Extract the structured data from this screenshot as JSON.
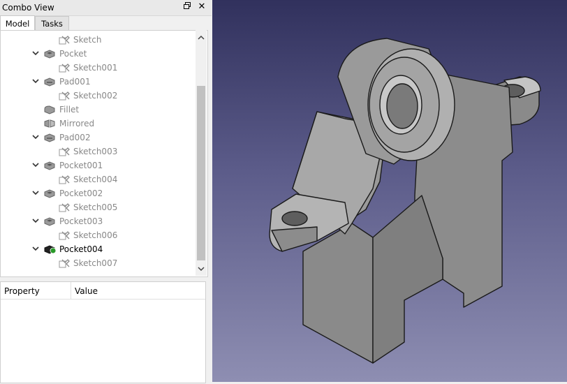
{
  "panel": {
    "title": "Combo View",
    "float_icon": "float-window-icon",
    "close_icon": "close-icon"
  },
  "tabs": [
    {
      "label": "Model",
      "active": true
    },
    {
      "label": "Tasks",
      "active": false
    }
  ],
  "tree": {
    "items": [
      {
        "label": "Sketch",
        "icon": "sketch-icon",
        "level": 2,
        "expanded": null
      },
      {
        "label": "Pocket",
        "icon": "pocket-icon",
        "level": 1,
        "expanded": true
      },
      {
        "label": "Sketch001",
        "icon": "sketch-icon",
        "level": 2,
        "expanded": null
      },
      {
        "label": "Pad001",
        "icon": "pad-icon",
        "level": 1,
        "expanded": true
      },
      {
        "label": "Sketch002",
        "icon": "sketch-icon",
        "level": 2,
        "expanded": null
      },
      {
        "label": "Fillet",
        "icon": "fillet-icon",
        "level": 1,
        "expanded": null
      },
      {
        "label": "Mirrored",
        "icon": "mirrored-icon",
        "level": 1,
        "expanded": null
      },
      {
        "label": "Pad002",
        "icon": "pad-icon",
        "level": 1,
        "expanded": true
      },
      {
        "label": "Sketch003",
        "icon": "sketch-icon",
        "level": 2,
        "expanded": null
      },
      {
        "label": "Pocket001",
        "icon": "pocket-icon",
        "level": 1,
        "expanded": true
      },
      {
        "label": "Sketch004",
        "icon": "sketch-icon",
        "level": 2,
        "expanded": null
      },
      {
        "label": "Pocket002",
        "icon": "pocket-icon",
        "level": 1,
        "expanded": true
      },
      {
        "label": "Sketch005",
        "icon": "sketch-icon",
        "level": 2,
        "expanded": null
      },
      {
        "label": "Pocket003",
        "icon": "pocket-icon",
        "level": 1,
        "expanded": true
      },
      {
        "label": "Sketch006",
        "icon": "sketch-icon",
        "level": 2,
        "expanded": null
      },
      {
        "label": "Pocket004",
        "icon": "pocket-tip-icon",
        "level": 1,
        "expanded": true,
        "active": true
      },
      {
        "label": "Sketch007",
        "icon": "sketch-icon",
        "level": 2,
        "expanded": null
      }
    ]
  },
  "properties": {
    "col_property": "Property",
    "col_value": "Value"
  },
  "viewport": {
    "model": "3d-part-model",
    "colors": {
      "bg_top": "#31315d",
      "bg_bottom": "#8e8eb2",
      "part": "#8c8c8c"
    }
  }
}
